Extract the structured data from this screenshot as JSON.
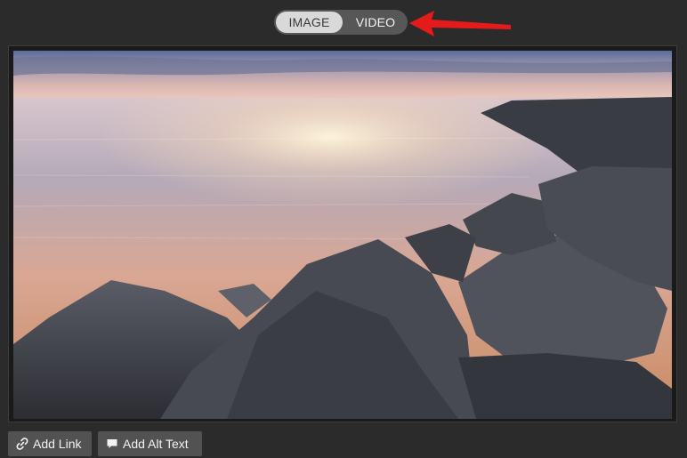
{
  "toggle": {
    "options": [
      {
        "label": "IMAGE",
        "selected": true
      },
      {
        "label": "VIDEO",
        "selected": false
      }
    ]
  },
  "image": {
    "subject": "sunset over calm water with rocky jetty"
  },
  "actions": {
    "add_link_label": "Add Link",
    "add_alt_label": "Add Alt Text"
  },
  "colors": {
    "background": "#2b2b2b",
    "toggle_track": "#575757",
    "toggle_selected": "#d9d9d9",
    "arrow": "#e31b1b",
    "button": "#525252"
  },
  "icons": {
    "link": "link-icon",
    "alt": "speech-bubble-icon"
  }
}
